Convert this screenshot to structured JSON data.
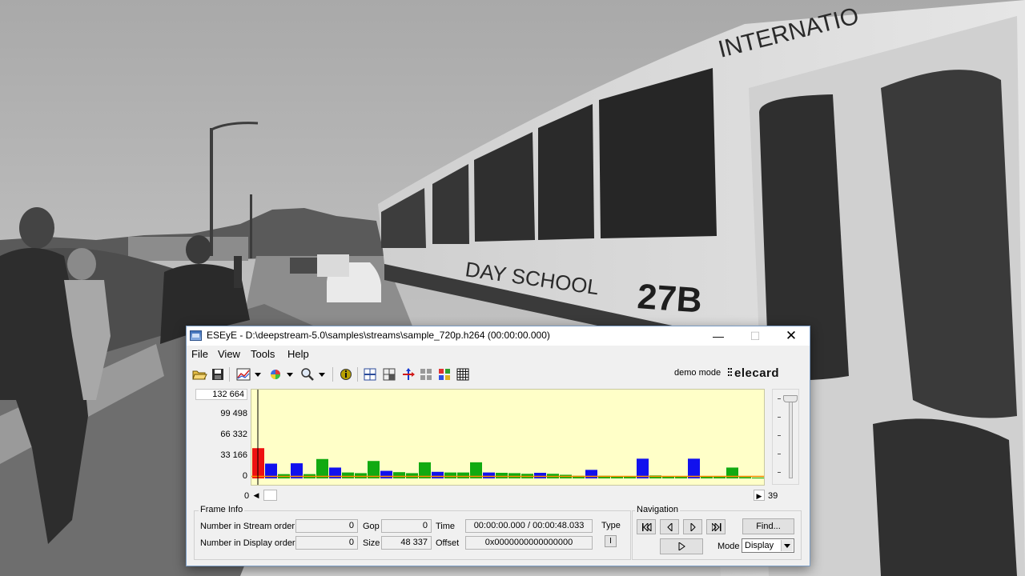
{
  "window": {
    "title": "ESEyE - D:\\deepstream-5.0\\samples\\streams\\sample_720p.h264 (00:00:00.000)",
    "minimize": "—",
    "maximize": "☐",
    "close": "✕"
  },
  "menu": [
    "File",
    "View",
    "Tools",
    "Help"
  ],
  "toolbar": {
    "icons": [
      "open-folder-icon",
      "save-icon",
      "chart-icon",
      "dropdown-icon",
      "color-wheel-icon",
      "dropdown-icon",
      "zoom-icon",
      "dropdown-icon",
      "info-icon",
      "grid-lines-icon",
      "grid-split-icon",
      "arrow-cross-icon",
      "tiles-icon",
      "color-tiles-icon",
      "grid-table-icon"
    ],
    "demo_mode": "demo mode",
    "logo_text": "elecard"
  },
  "chart_data": {
    "type": "bar",
    "title": "",
    "xlabel": "",
    "ylabel": "",
    "y_ticks": [
      "132 664",
      "99 498",
      "66 332",
      "33 166",
      "0"
    ],
    "ylim": [
      0,
      132664
    ],
    "x_start": "0",
    "x_end": "39",
    "background": "#ffffc8",
    "reference_line_color": "#ff8a00",
    "frame_colors": {
      "I": "#ee1111",
      "P": "#1111ee",
      "B": "#11aa11"
    },
    "frame_types": [
      "I",
      "P",
      "B",
      "P",
      "B",
      "B",
      "P",
      "B",
      "B",
      "B",
      "P",
      "B",
      "B",
      "B",
      "P",
      "B",
      "B",
      "B",
      "P",
      "B",
      "B",
      "B",
      "P",
      "B",
      "B",
      "B",
      "P",
      "B",
      "B",
      "B",
      "P",
      "B",
      "B",
      "B",
      "P",
      "B",
      "B",
      "B",
      "B",
      "B"
    ],
    "values": [
      46000,
      22500,
      6500,
      23000,
      6500,
      29500,
      16500,
      9000,
      8000,
      26500,
      11500,
      9500,
      8000,
      24500,
      10000,
      9000,
      9000,
      24500,
      9000,
      8500,
      8000,
      7000,
      8500,
      7000,
      5500,
      4000,
      13000,
      4000,
      3500,
      3000,
      30000,
      4500,
      3500,
      3000,
      30000,
      3500,
      2500,
      16500,
      2000,
      1000
    ],
    "selected_index": 0,
    "grid": false
  },
  "frame_info": {
    "legend": "Frame Info",
    "stream_order_label": "Number in Stream order",
    "stream_order_value": "0",
    "display_order_label": "Number in Display order",
    "display_order_value": "0",
    "gop_label": "Gop",
    "gop_value": "0",
    "size_label": "Size",
    "size_value": "48 337",
    "time_label": "Time",
    "time_value": "00:00:00.000 / 00:00:48.033",
    "offset_label": "Offset",
    "offset_value": "0x0000000000000000",
    "type_label": "Type",
    "type_value": "I"
  },
  "navigation": {
    "legend": "Navigation",
    "find_label": "Find...",
    "mode_label": "Mode",
    "mode_value": "Display"
  }
}
